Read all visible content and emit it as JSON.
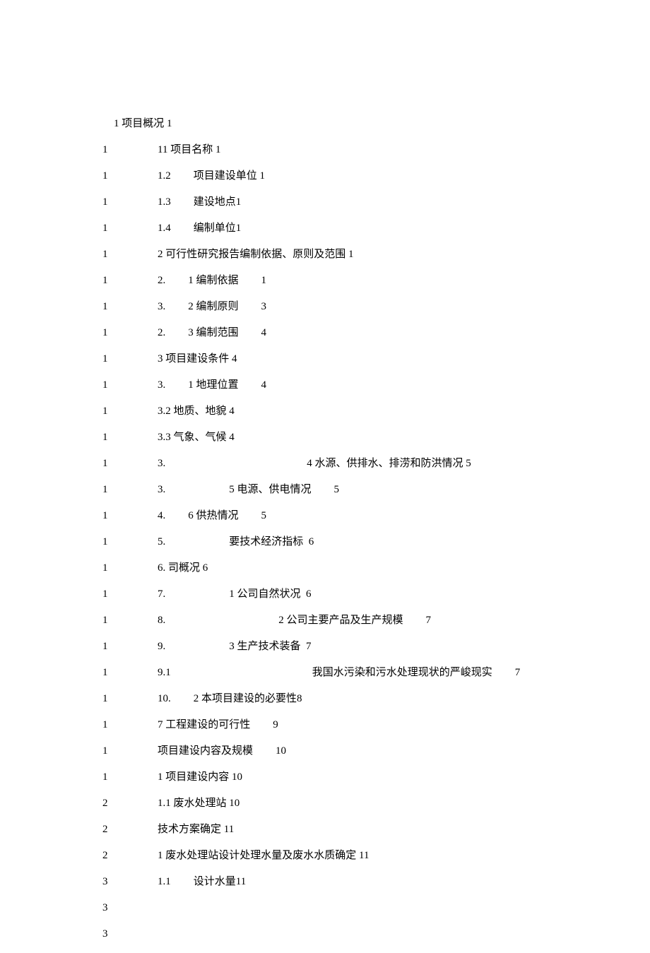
{
  "lines": [
    {
      "num": "",
      "indent": true,
      "segs": [
        "1 项目概况 1"
      ]
    },
    {
      "num": "1",
      "segs": [
        "11 项目名称 1"
      ]
    },
    {
      "num": "1",
      "segs": [
        "1.2",
        "",
        "项目建设单位 1"
      ],
      "gaps": [
        "sm"
      ]
    },
    {
      "num": "1",
      "segs": [
        "1.3",
        "",
        "建设地点1"
      ],
      "gaps": [
        "sm"
      ]
    },
    {
      "num": "1",
      "segs": [
        "1.4",
        "",
        "编制单位1"
      ],
      "gaps": [
        "sm"
      ]
    },
    {
      "num": "1",
      "segs": [
        "2 可行性研究报告编制依据、原则及范围 1"
      ]
    },
    {
      "num": "1",
      "segs": [
        "2.",
        "",
        "1 编制依据",
        "",
        "1"
      ],
      "gaps": [
        "sm",
        "sm"
      ]
    },
    {
      "num": "1",
      "segs": [
        "3.",
        "",
        "2 编制原则",
        "",
        "3"
      ],
      "gaps": [
        "sm",
        "sm"
      ]
    },
    {
      "num": "1",
      "segs": [
        "2.",
        "",
        "3 编制范围",
        "",
        "4"
      ],
      "gaps": [
        "sm",
        "sm"
      ]
    },
    {
      "num": "1",
      "segs": [
        "3 项目建设条件 4"
      ]
    },
    {
      "num": "1",
      "segs": [
        "3.",
        "",
        "1 地理位置",
        "",
        "4"
      ],
      "gaps": [
        "sm",
        "sm"
      ]
    },
    {
      "num": "1",
      "segs": [
        "3.2 地质、地貌 4"
      ]
    },
    {
      "num": "1",
      "segs": [
        "3.3 气象、气候 4"
      ]
    },
    {
      "num": "1",
      "segs": [
        "3.",
        "",
        "4 水源、供排水、排涝和防洪情况 5"
      ],
      "gaps": [
        "xxl"
      ]
    },
    {
      "num": "1",
      "segs": [
        "3.",
        "",
        "5 电源、供电情况",
        "",
        "5"
      ],
      "gaps": [
        "lg",
        "sm"
      ]
    },
    {
      "num": "1",
      "segs": [
        "4.",
        "",
        "6 供热情况",
        "",
        "5"
      ],
      "gaps": [
        "sm",
        "sm"
      ]
    },
    {
      "num": "1",
      "segs": [
        "5.",
        "",
        "要技术经济指标  6"
      ],
      "gaps": [
        "lg"
      ]
    },
    {
      "num": "1",
      "segs": [
        "6. 司概况 6"
      ]
    },
    {
      "num": "1",
      "segs": [
        "7.",
        "",
        "1 公司自然状况  6"
      ],
      "gaps": [
        "lg"
      ]
    },
    {
      "num": "1",
      "segs": [
        "8.",
        "",
        "2 公司主要产品及生产规模",
        "",
        "7"
      ],
      "gaps": [
        "xl",
        "sm"
      ]
    },
    {
      "num": "1",
      "segs": [
        "9.",
        "",
        "3 生产技术装备  7"
      ],
      "gaps": [
        "lg"
      ]
    },
    {
      "num": "1",
      "segs": [
        "9.1",
        "",
        "我国水污染和污水处理现状的严峻现实",
        "",
        "7"
      ],
      "gaps": [
        "xxl",
        "sm"
      ]
    },
    {
      "num": "1",
      "segs": [
        "10.",
        "",
        "2 本项目建设的必要性8"
      ],
      "gaps": [
        "sm"
      ]
    },
    {
      "num": "1",
      "segs": [
        "7 工程建设的可行性",
        "",
        "9"
      ],
      "gaps": [
        "sm"
      ]
    },
    {
      "num": "1",
      "segs": [
        "项目建设内容及规模",
        "",
        "10"
      ],
      "gaps": [
        "sm"
      ]
    },
    {
      "num": "1",
      "segs": [
        "1 项目建设内容 10"
      ]
    },
    {
      "num": "2",
      "segs": [
        "1.1 废水处理站 10"
      ]
    },
    {
      "num": "2",
      "segs": [
        "技术方案确定 11"
      ]
    },
    {
      "num": "2",
      "segs": [
        "1 废水处理站设计处理水量及废水水质确定 11"
      ]
    },
    {
      "num": "3",
      "segs": [
        "1.1",
        "",
        "设计水量11"
      ],
      "gaps": [
        "sm"
      ]
    },
    {
      "num": "3",
      "segs": [
        ""
      ]
    },
    {
      "num": "3",
      "segs": [
        ""
      ]
    }
  ]
}
